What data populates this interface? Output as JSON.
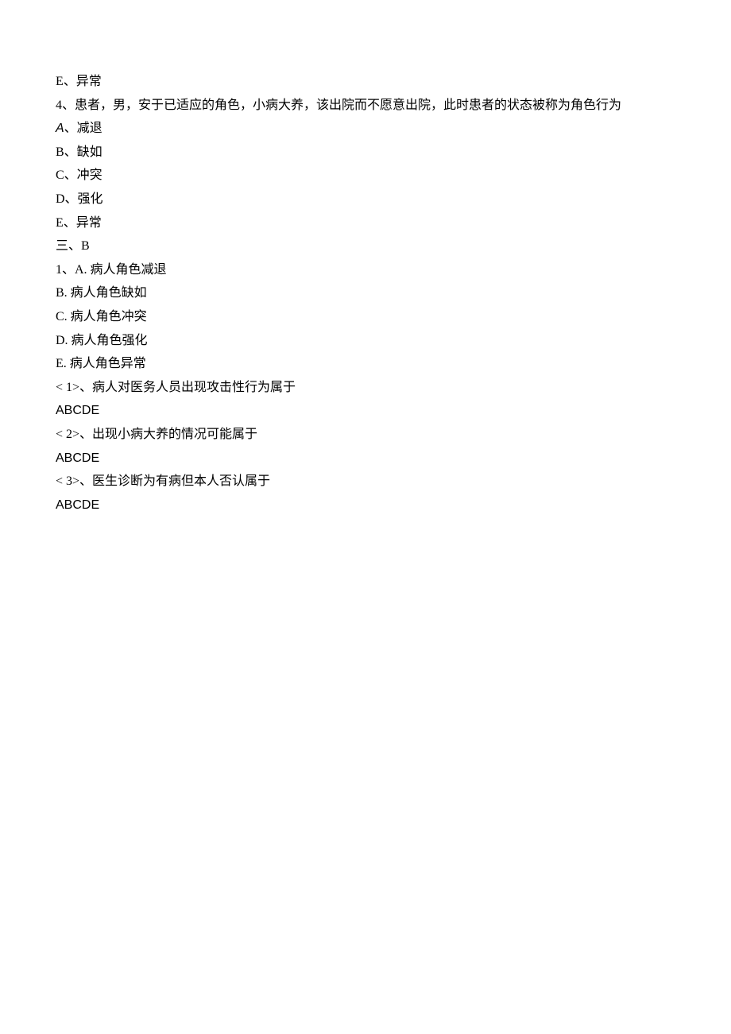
{
  "lines": {
    "l1": "E、异常",
    "l2": "4、患者，男，安于已适应的角色，小病大养，该出院而不愿意出院，此时患者的状态被称为角色行为",
    "l3a": "A",
    "l3b": "、减退",
    "l4": "B、缺如",
    "l5": "C、冲突",
    "l6": "D、强化",
    "l7": "E、异常",
    "l8": "三、B",
    "l9": "1、A. 病人角色减退",
    "l10": "B. 病人角色缺如",
    "l11": "C. 病人角色冲突",
    "l12": "D. 病人角色强化",
    "l13": "E. 病人角色异常",
    "l14": "<  1>、病人对医务人员出现攻击性行为属于",
    "l15": "ABCDE",
    "l16": "<  2>、出现小病大养的情况可能属于",
    "l17": "ABCDE",
    "l18": "<  3>、医生诊断为有病但本人否认属于",
    "l19": "ABCDE"
  }
}
